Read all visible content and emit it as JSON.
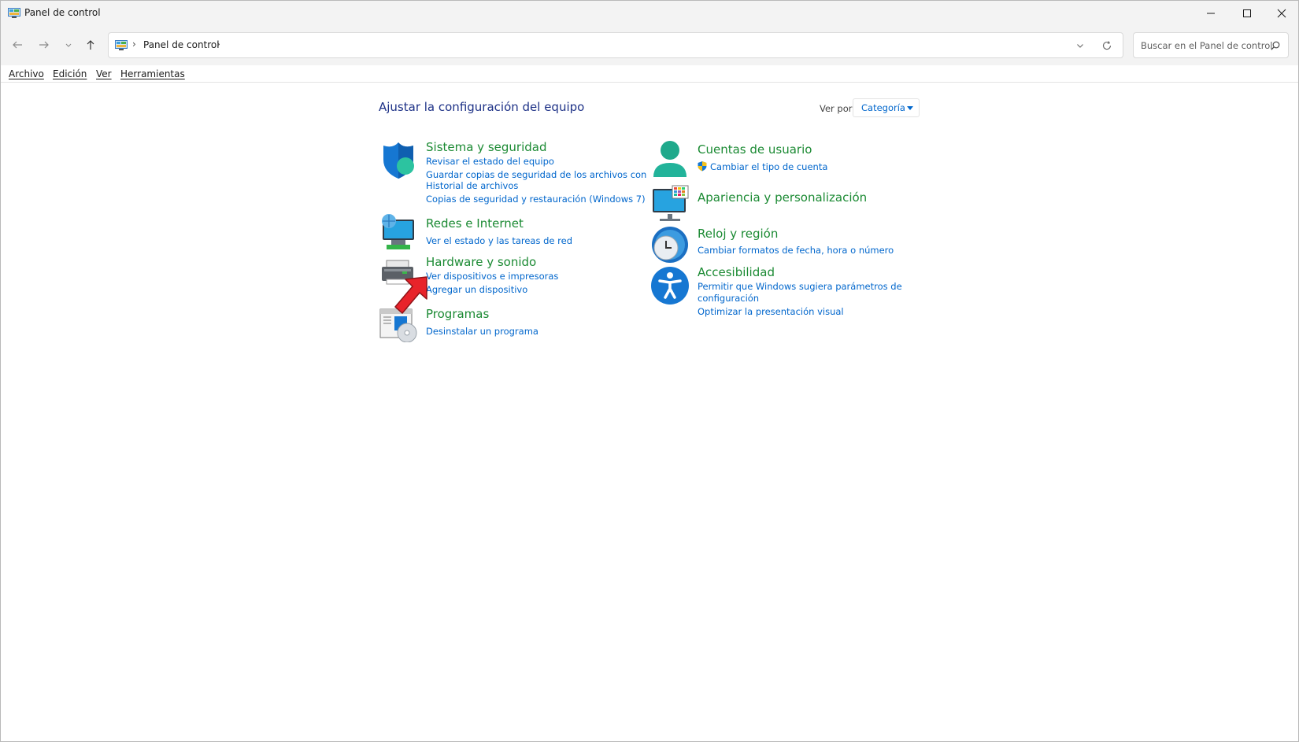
{
  "window": {
    "title": "Panel de control",
    "minimize": "minimize-icon",
    "maximize": "maximize-icon",
    "close": "close-icon"
  },
  "nav": {
    "breadcrumb": "Panel de control",
    "search_placeholder": "Buscar en el Panel de control"
  },
  "menu": [
    "Archivo",
    "Edición",
    "Ver",
    "Herramientas"
  ],
  "content": {
    "heading": "Ajustar la configuración del equipo",
    "view_by_label": "Ver por:",
    "view_by_value": "Categoría",
    "categories": [
      {
        "title": "Sistema y seguridad",
        "icon": "shield-icon",
        "links": [
          "Revisar el estado del equipo",
          "Guardar copias de seguridad de los archivos con",
          "Historial de archivos",
          "Copias de seguridad y restauración (Windows 7)"
        ]
      },
      {
        "title": "Redes e Internet",
        "icon": "network-icon",
        "links": [
          "Ver el estado y las tareas de red"
        ]
      },
      {
        "title": "Hardware y sonido",
        "icon": "printer-icon",
        "links": [
          "Ver dispositivos e impresoras",
          "Agregar un dispositivo"
        ]
      },
      {
        "title": "Programas",
        "icon": "programs-icon",
        "links": [
          "Desinstalar un programa"
        ]
      },
      {
        "title": "Cuentas de usuario",
        "icon": "user-icon",
        "links": [
          "Cambiar el tipo de cuenta"
        ]
      },
      {
        "title": "Apariencia y personalización",
        "icon": "appearance-icon",
        "links": []
      },
      {
        "title": "Reloj y región",
        "icon": "clock-icon",
        "links": [
          "Cambiar formatos de fecha, hora o número"
        ]
      },
      {
        "title": "Accesibilidad",
        "icon": "accessibility-icon",
        "links": [
          "Permitir que Windows sugiera parámetros de",
          "configuración",
          "Optimizar la presentación visual"
        ]
      }
    ]
  },
  "colors": {
    "category_title": "#1b8a33",
    "link": "#0066cc",
    "heading": "#1e3287",
    "annotation_arrow": "#e8232a"
  }
}
